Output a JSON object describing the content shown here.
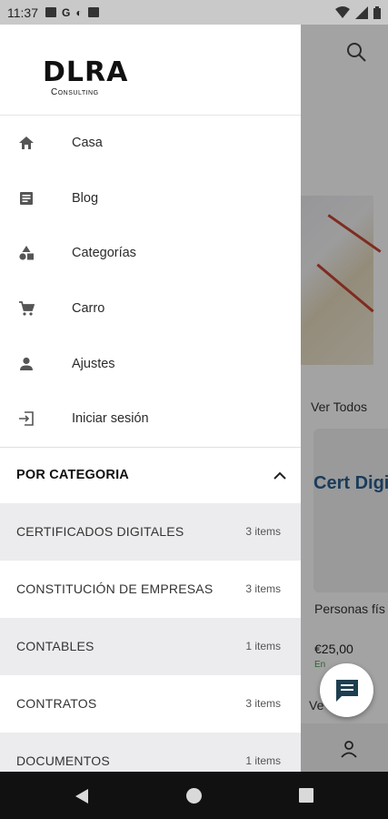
{
  "status_bar": {
    "time": "11:37",
    "left_icons": [
      "mail-icon",
      "google-icon",
      "vpn-icon",
      "sd-card-icon"
    ],
    "right_icons": [
      "wifi-icon",
      "signal-icon",
      "battery-icon"
    ]
  },
  "logo": {
    "mark": "DLRA",
    "sub": "Consulting"
  },
  "menu": [
    {
      "label": "Casa",
      "icon": "home-icon"
    },
    {
      "label": "Blog",
      "icon": "article-icon"
    },
    {
      "label": "Categorías",
      "icon": "category-icon"
    },
    {
      "label": "Carro",
      "icon": "cart-icon"
    },
    {
      "label": "Ajustes",
      "icon": "person-icon"
    },
    {
      "label": "Iniciar sesión",
      "icon": "login-icon"
    }
  ],
  "category_section": {
    "title": "POR CATEGORIA",
    "expanded": true,
    "items": [
      {
        "name": "CERTIFICADOS DIGITALES",
        "count": "3 items"
      },
      {
        "name": "CONSTITUCIÓN DE EMPRESAS",
        "count": "3 items"
      },
      {
        "name": "CONTABLES",
        "count": "1 items"
      },
      {
        "name": "CONTRATOS",
        "count": "3 items"
      },
      {
        "name": "DOCUMENTOS",
        "count": "1 items"
      }
    ]
  },
  "background": {
    "ver_todos": "Ver Todos",
    "card_title": "Cert Digi",
    "product_name": "Personas fís",
    "price": "€25,00",
    "stock": "En",
    "ver_todos_2": "Ve"
  },
  "colors": {
    "accent": "#1d3e4f",
    "drawer_shade": "#ececee",
    "scrim": "rgba(0,0,0,0.36)"
  }
}
